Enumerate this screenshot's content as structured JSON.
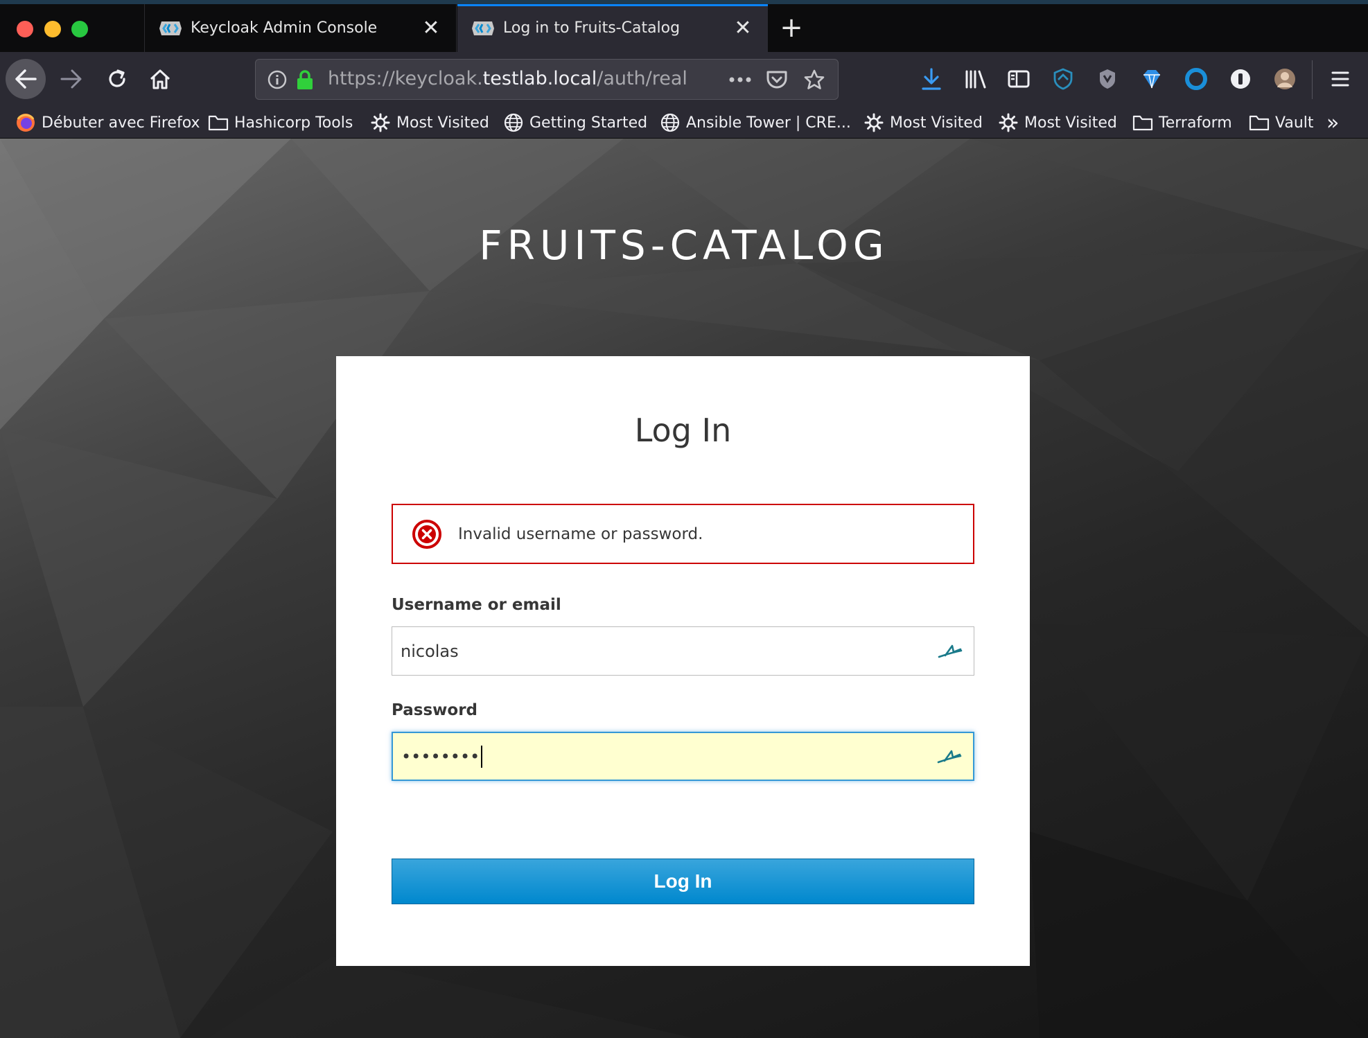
{
  "browser": {
    "tabs": [
      {
        "title": "Keycloak Admin Console",
        "active": false
      },
      {
        "title": "Log in to Fruits-Catalog",
        "active": true
      }
    ],
    "url": {
      "prefix": "https://keycloak.",
      "host": "testlab.local",
      "path": "/auth/realm"
    },
    "bookmarks": [
      {
        "label": "Débuter avec Firefox",
        "icon": "firefox-icon"
      },
      {
        "label": "Hashicorp Tools",
        "icon": "folder-icon"
      },
      {
        "label": "Most Visited",
        "icon": "gear-icon"
      },
      {
        "label": "Getting Started",
        "icon": "globe-icon"
      },
      {
        "label": "Ansible Tower | CRE...",
        "icon": "globe-icon"
      },
      {
        "label": "Most Visited",
        "icon": "gear-icon"
      },
      {
        "label": "Most Visited",
        "icon": "gear-icon"
      },
      {
        "label": "Terraform",
        "icon": "folder-icon"
      },
      {
        "label": "Vault",
        "icon": "folder-icon"
      }
    ]
  },
  "login": {
    "realm_title": "FRUITS-CATALOG",
    "heading": "Log In",
    "error_message": "Invalid username or password.",
    "username_label": "Username or email",
    "username_value": "nicolas",
    "password_label": "Password",
    "password_value": "••••••••",
    "submit_label": "Log In"
  },
  "colors": {
    "error": "#cc0000",
    "primary_button": "#0088ce",
    "focus_border": "#3598d6",
    "autofill_bg": "#ffffd0"
  }
}
